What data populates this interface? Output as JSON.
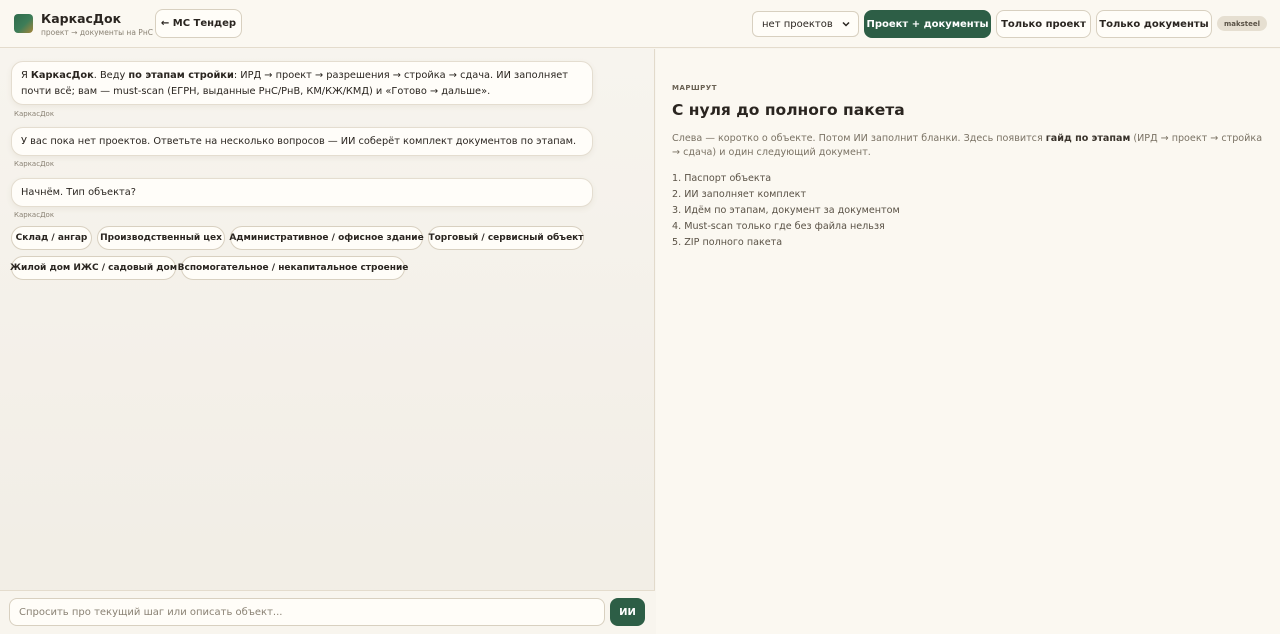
{
  "header": {
    "brand_title": "КаркасДок",
    "brand_subtitle": "проект → документы на РнС",
    "back_button": "← МС Тендер",
    "project_select": "нет проектов",
    "mode_buttons": [
      "Проект + документы",
      "Только проект",
      "Только документы"
    ],
    "user": "maksteel"
  },
  "chat": {
    "messages": [
      {
        "parts": [
          "Я ",
          "КаркасДок",
          ". Веду ",
          "по этапам стройки",
          ": ИРД → проект → разрешения → стройка → сдача. ИИ заполняет почти всё; вам — must-scan (ЕГРН, выданные РнС/РнВ, КМ/КЖ/КМД) и «Готово → дальше»."
        ],
        "sender": "КаркасДок"
      },
      {
        "text": "У вас пока нет проектов. Ответьте на несколько вопросов — ИИ соберёт комплект документов по этапам.",
        "sender": "КаркасДок"
      },
      {
        "text": "Начнём. Тип объекта?",
        "sender": "КаркасДок"
      }
    ],
    "options": [
      "Склад / ангар",
      "Производственный цех",
      "Административное / офисное здание",
      "Торговый / сервисный объект",
      "Жилой дом ИЖС / садовый дом",
      "Вспомогательное / некапитальное строение"
    ],
    "input_placeholder": "Спросить про текущий шаг или описать объект...",
    "send_label": "ИИ"
  },
  "route": {
    "label": "МАРШРУТ",
    "title": "С нуля до полного пакета",
    "desc_parts": [
      "Слева — коротко о объекте. Потом ИИ заполнит бланки. Здесь появится ",
      "гайд по этапам",
      " (ИРД → проект → стройка → сдача) и один следующий документ."
    ],
    "steps": [
      "1. Паспорт объекта",
      "2. ИИ заполняет комплект",
      "3. Идём по этапам, документ за документом",
      "4. Must-scan только где без файла нельзя",
      "5. ZIP полного пакета"
    ]
  },
  "colors": {
    "accent": "#2d5e46",
    "background": "#f8f5ee",
    "border": "#d8d0c0"
  },
  "icons": {
    "logo": "brand-logo-icon",
    "select_arrow": "chevron-down-icon"
  }
}
